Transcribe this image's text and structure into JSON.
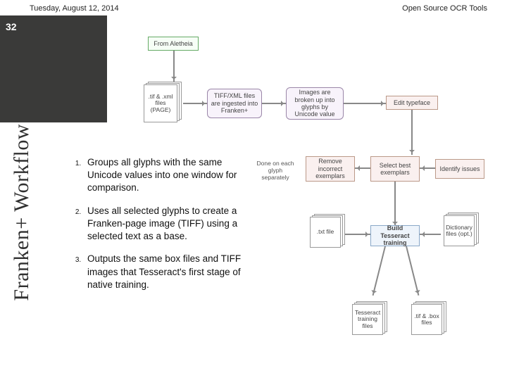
{
  "header": {
    "date": "Tuesday, August 12, 2014",
    "title": "Open Source OCR Tools"
  },
  "slide_number": "32",
  "vertical_title": "Franken+ Workflow",
  "bullets": [
    "Groups all glyphs with the same Unicode values into one window for comparison.",
    "Uses all selected glyphs to create a Franken-page image (TIFF) using a selected text as a base.",
    "Outputs the same box files and TIFF images that Tesseract's first stage of native training."
  ],
  "diagram": {
    "top_source": "From Aletheia",
    "stack1": ".tif & .xml files (PAGE)",
    "ingest": "TIFF/XML files are ingested into Franken+",
    "breakup": "Images are broken up into glyphs by Unicode value",
    "edit": "Edit typeface",
    "sidecap": "Done on each glyph separately",
    "remove": "Remove incorrect exemplars",
    "select": "Select best exemplars",
    "identify": "Identify issues",
    "txt": ".txt file",
    "build": "Build Tesseract training",
    "dict": "Dictionary files (opt.)",
    "out_left": "Tesseract training files",
    "out_right": ".tif & .box files"
  }
}
